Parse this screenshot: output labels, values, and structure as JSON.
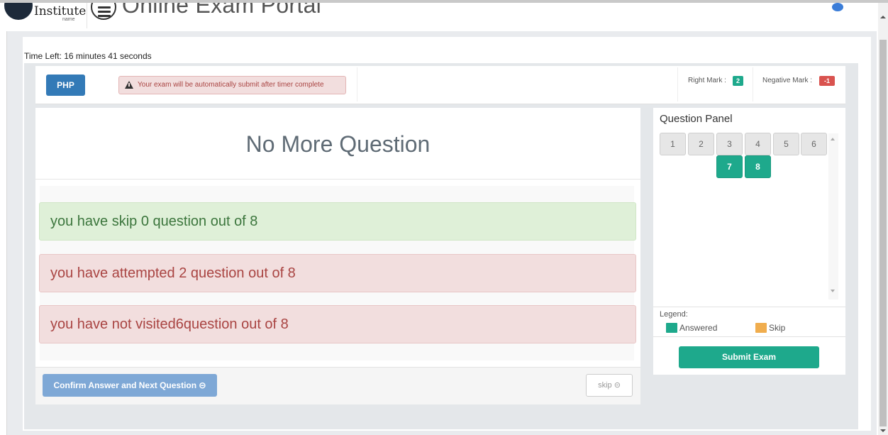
{
  "header": {
    "logo_text": "Institute",
    "logo_sub": "name",
    "portal_title": "Online Exam Portal"
  },
  "timer": {
    "text": "Time Left: 16 minutes 41 seconds"
  },
  "topbar": {
    "subject_button": "PHP",
    "alert_text": "Your exam will be automatically submit after timer complete",
    "right_mark_label": "Right Mark :",
    "right_mark_value": "2",
    "negative_mark_label": "Negative Mark :",
    "negative_mark_value": "-1"
  },
  "main": {
    "heading": "No More Question",
    "results": [
      {
        "text": "you have skip 0 question out of 8",
        "status": "success"
      },
      {
        "text": "you have attempted 2 question out of 8",
        "status": "danger"
      },
      {
        "text": "you have not visited6question out of 8",
        "status": "danger"
      }
    ],
    "confirm_button": "Confirm Answer and Next Question ⊝",
    "skip_button": "skip ⊝"
  },
  "question_panel": {
    "title": "Question Panel",
    "questions": [
      {
        "number": "1",
        "state": "not-visited"
      },
      {
        "number": "2",
        "state": "not-visited"
      },
      {
        "number": "3",
        "state": "not-visited"
      },
      {
        "number": "4",
        "state": "not-visited"
      },
      {
        "number": "5",
        "state": "not-visited"
      },
      {
        "number": "6",
        "state": "not-visited"
      },
      {
        "number": "7",
        "state": "answered"
      },
      {
        "number": "8",
        "state": "answered"
      }
    ],
    "legend_title": "Legend:",
    "legend": [
      {
        "label": "Answered",
        "color": "#1ea98c"
      },
      {
        "label": "Skip",
        "color": "#f0ad4e"
      }
    ],
    "submit_button": "Submit Exam"
  },
  "colors": {
    "primary": "#337ab7",
    "answered": "#1ea98c",
    "skip": "#f0ad4e",
    "danger": "#d9534f"
  }
}
